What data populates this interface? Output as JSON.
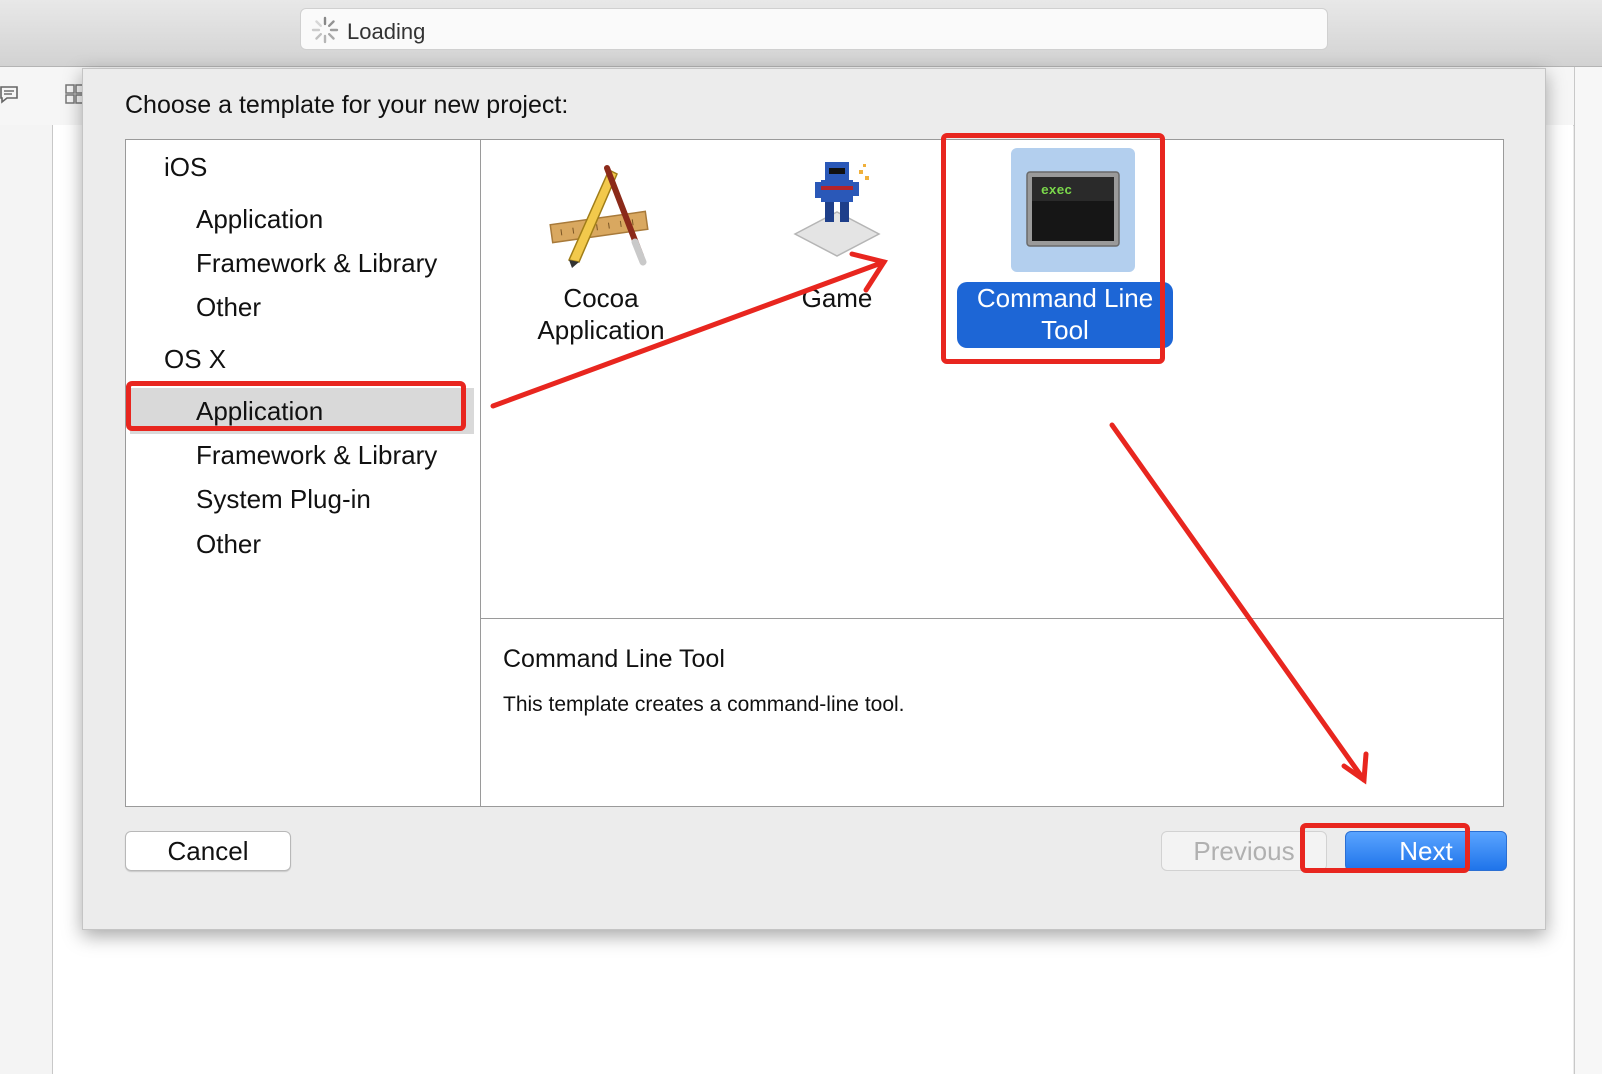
{
  "titlebar": {
    "status_text": "Loading"
  },
  "sheet": {
    "title": "Choose a template for your new project:",
    "sidebar": {
      "groups": [
        {
          "label": "iOS",
          "items": [
            "Application",
            "Framework & Library",
            "Other"
          ]
        },
        {
          "label": "OS X",
          "items": [
            "Application",
            "Framework & Library",
            "System Plug-in",
            "Other"
          ]
        }
      ],
      "selected": "OS X / Application"
    },
    "templates": [
      {
        "name": "Cocoa Application",
        "line1": "Cocoa",
        "line2": "Application",
        "icon": "cocoa-app-icon"
      },
      {
        "name": "Game",
        "line1": "Game",
        "line2": "",
        "icon": "game-ninja-icon"
      },
      {
        "name": "Command Line Tool",
        "line1": "Command Line",
        "line2": "Tool",
        "icon": "terminal-exec-icon",
        "icon_text": "exec",
        "selected": true
      }
    ],
    "description": {
      "title": "Command Line Tool",
      "text": "This template creates a command-line tool."
    },
    "buttons": {
      "cancel": "Cancel",
      "previous": "Previous",
      "next": "Next"
    }
  },
  "colors": {
    "accent": "#1d66d6",
    "annotation_red": "#e8261f",
    "selection_gray": "#d9d9d9"
  }
}
